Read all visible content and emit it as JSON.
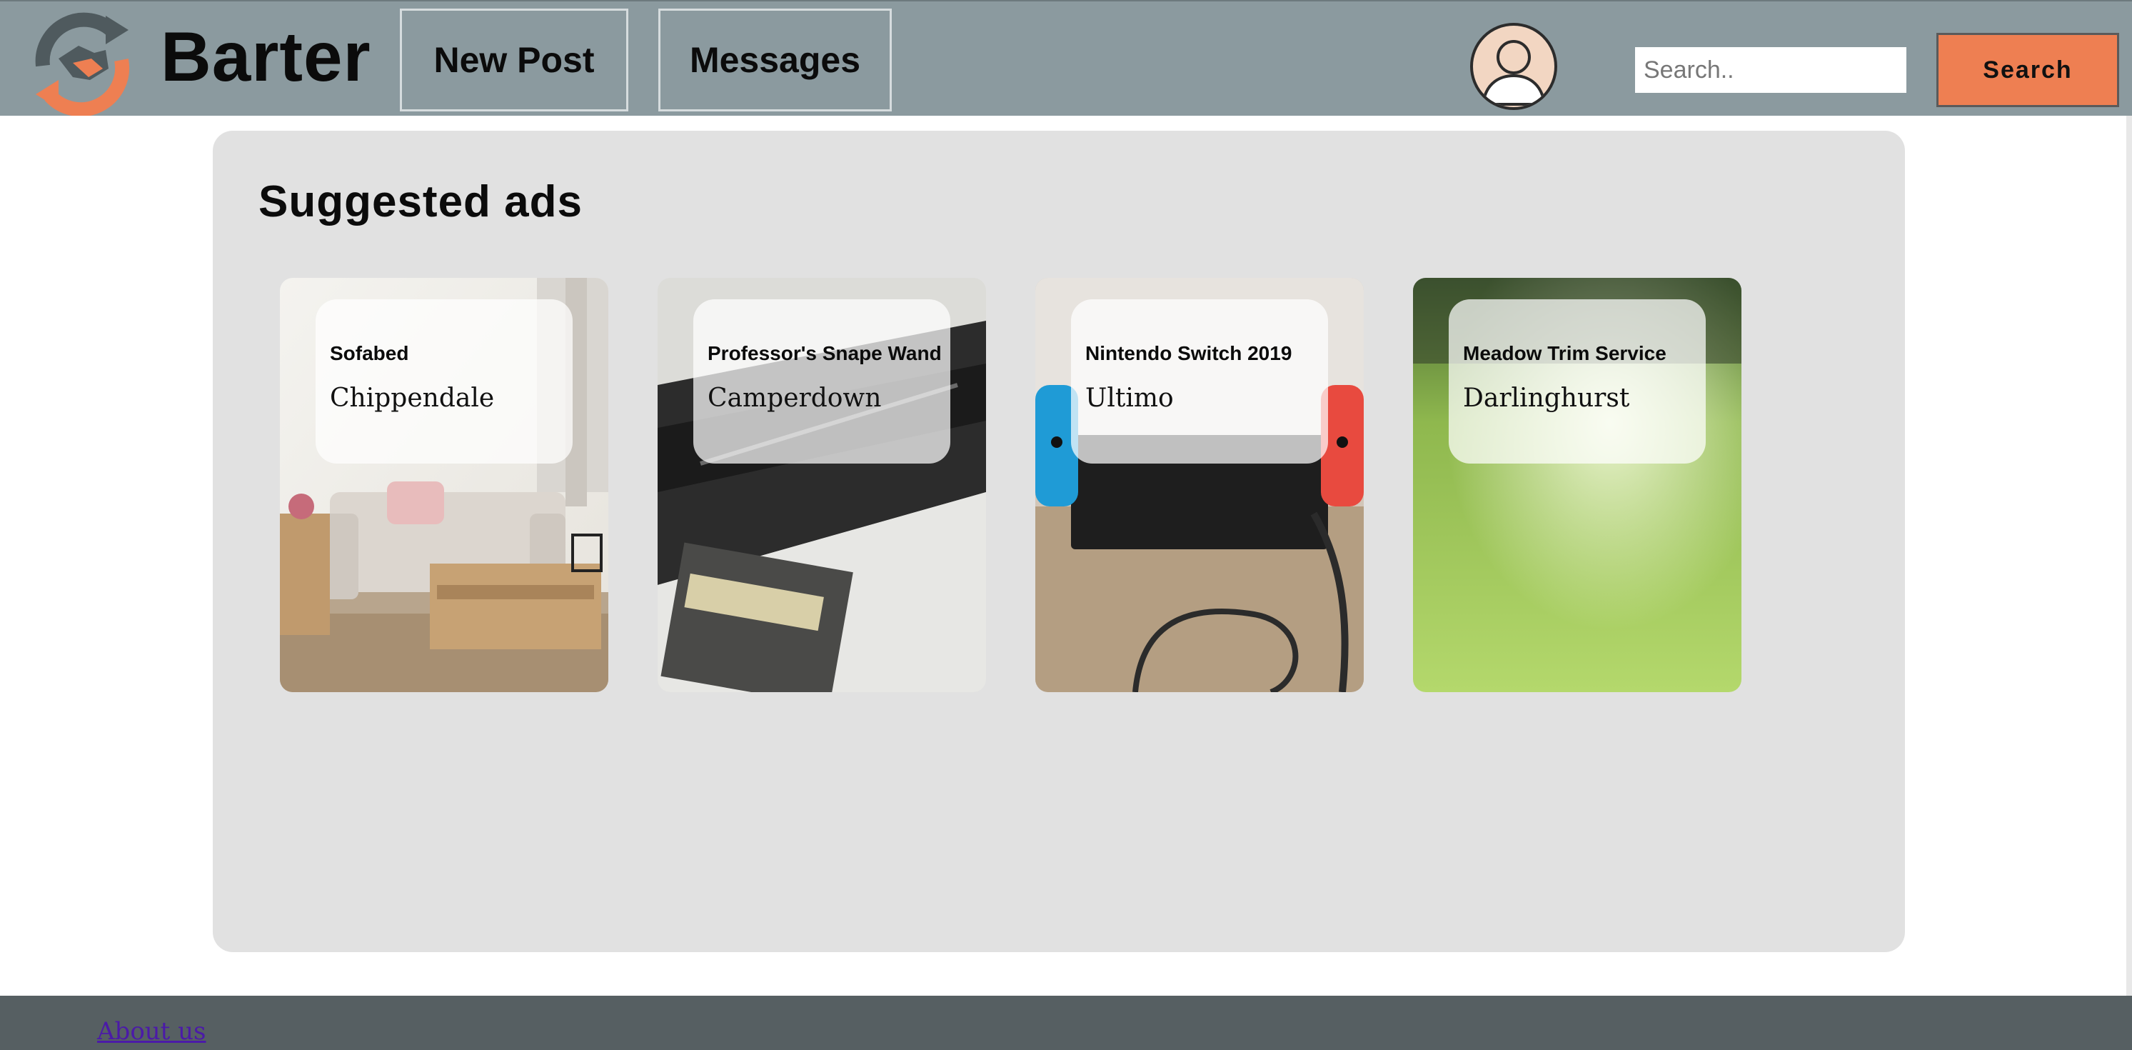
{
  "header": {
    "brand": "Barter",
    "nav": [
      {
        "label": "New Post"
      },
      {
        "label": "Messages"
      }
    ],
    "search": {
      "placeholder": "Search..",
      "value": "",
      "button_label": "Search"
    },
    "colors": {
      "header_bg": "#8b9a9f",
      "accent": "#ee7f52"
    }
  },
  "main": {
    "title": "Suggested ads",
    "ads": [
      {
        "title": "Sofabed",
        "location": "Chippendale",
        "image": "living-room-sofa-photo"
      },
      {
        "title": "Professor's Snape Wand",
        "location": "Camperdown",
        "image": "wand-box-photo"
      },
      {
        "title": "Nintendo Switch 2019",
        "location": "Ultimo",
        "image": "nintendo-switch-photo"
      },
      {
        "title": "Meadow Trim Service",
        "location": "Darlinghurst",
        "image": "grass-lawn-photo"
      }
    ]
  },
  "footer": {
    "about_link": "About us"
  }
}
